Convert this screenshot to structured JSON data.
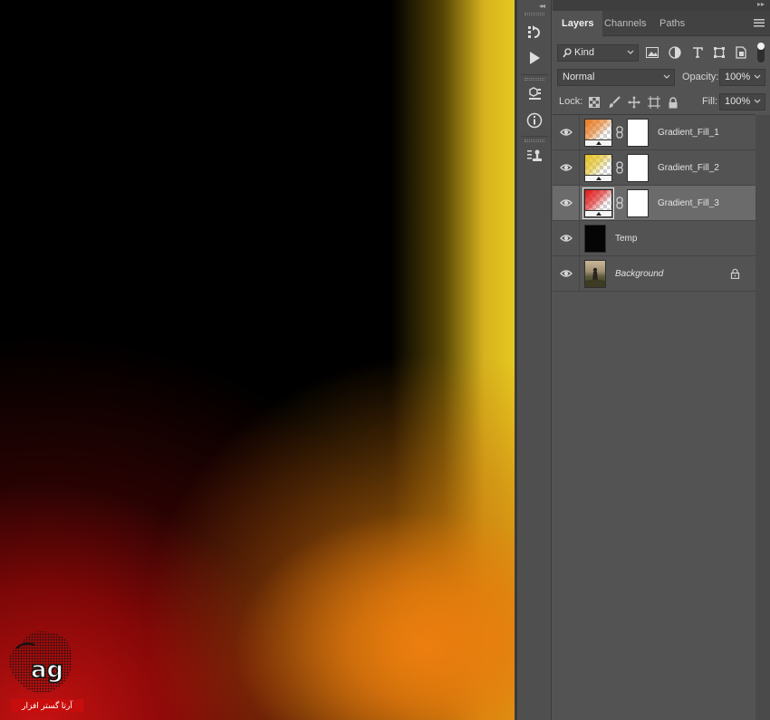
{
  "canvas": {
    "watermark_text": "آرتا گستر افزار"
  },
  "toolbar": {
    "collapse": "◂◂",
    "tools": [
      {
        "name": "history-brush-icon",
        "interactable": true
      },
      {
        "name": "play-action-icon",
        "interactable": true
      },
      {
        "name": "3d-cube-icon",
        "interactable": true
      },
      {
        "name": "info-icon",
        "interactable": true
      },
      {
        "name": "clone-source-icon",
        "interactable": true
      }
    ]
  },
  "panel": {
    "collapse": "▸▸",
    "tabs": [
      {
        "label": "Layers",
        "active": true
      },
      {
        "label": "Channels",
        "active": false
      },
      {
        "label": "Paths",
        "active": false
      }
    ],
    "filter": {
      "kind_value": "Kind",
      "icons": [
        "image-filter-icon",
        "adjustment-filter-icon",
        "type-filter-icon",
        "shape-filter-icon",
        "smart-object-filter-icon"
      ]
    },
    "blend": {
      "mode": "Normal",
      "opacity_label": "Opacity:",
      "opacity_value": "100%"
    },
    "lock": {
      "label": "Lock:",
      "icons": [
        "lock-transparent-pixels-icon",
        "lock-image-pixels-icon",
        "lock-position-icon",
        "lock-artboard-icon",
        "lock-all-icon"
      ],
      "fill_label": "Fill:",
      "fill_value": "100%"
    },
    "layers": [
      {
        "name": "Gradient_Fill_1",
        "type": "gradient",
        "colors": [
          "#e8781c",
          "#f09a3a"
        ],
        "selected": false
      },
      {
        "name": "Gradient_Fill_2",
        "type": "gradient",
        "colors": [
          "#e4c21f",
          "#efd84a"
        ],
        "selected": false
      },
      {
        "name": "Gradient_Fill_3",
        "type": "gradient",
        "colors": [
          "#e21414",
          "#f04040"
        ],
        "selected": true
      },
      {
        "name": "Temp",
        "type": "fill",
        "colors": [
          "#000000"
        ],
        "selected": false
      },
      {
        "name": "Background",
        "type": "photo",
        "locked": true,
        "selected": false
      }
    ]
  }
}
